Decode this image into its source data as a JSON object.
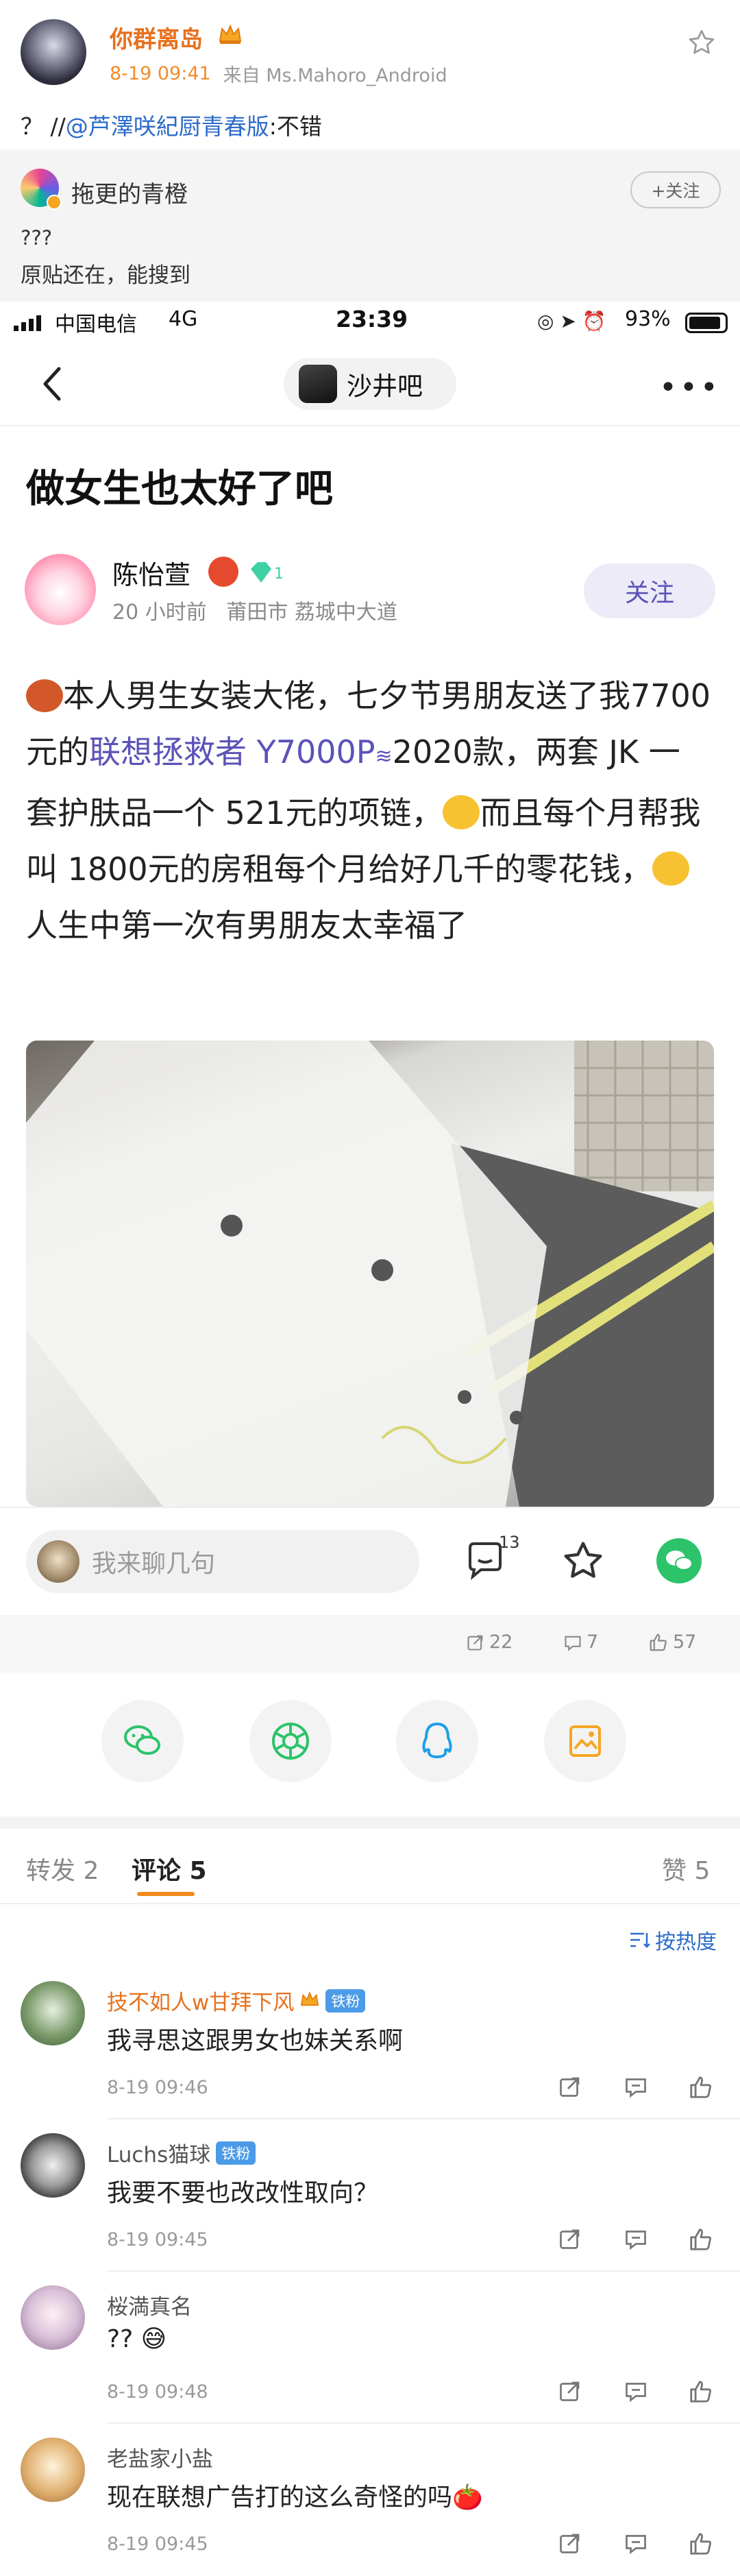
{
  "post": {
    "author": "你群离岛",
    "date": "8-19 09:41",
    "source": "来自 Ms.Mahoro_Android",
    "repost_prefix": "？ //",
    "mention": "@芦澤咲紀厨青春版",
    "repost_suffix": ":不错"
  },
  "quoted": {
    "author": "拖更的青橙",
    "follow_label": "+关注",
    "line1": "???",
    "line2": "原贴还在，能搜到"
  },
  "screenshot": {
    "status": {
      "carrier": "中国电信",
      "network": "4G",
      "time": "23:39",
      "battery": "93%"
    },
    "forum": "沙井吧",
    "title": "做女生也太好了吧",
    "user": {
      "name": "陈怡萱",
      "level": "1",
      "meta": "20 小时前   莆田市 荔城中大道",
      "follow": "关注"
    },
    "body": {
      "p1a": "本人男生女装大佬，七夕节男朋友送了我7700元的",
      "p1link": "联想拯救者 Y7000P",
      "p1b": "2020款，两套 JK 一套护肤品一个 521元的项链，",
      "p1c": "而且每个月帮我叫 1800元的房租每个月给好几千的零花钱，",
      "p1d": "人生中第一次有男朋友太幸福了"
    },
    "chat_placeholder": "我来聊几句",
    "comment_count": "13"
  },
  "stats": {
    "reposts": "22",
    "comments": "7",
    "likes": "57"
  },
  "tabs": {
    "repost": "转发 2",
    "comment": "评论 5",
    "like": "赞 5"
  },
  "sort_label": "按热度",
  "comments": [
    {
      "name": "技不如人w甘拜下风",
      "badge": "铁粉",
      "text": "我寻思这跟男女也妹关系啊",
      "time": "8-19 09:46"
    },
    {
      "name": "Luchs猫球",
      "badge": "铁粉",
      "text": "我要不要也改改性取向？",
      "time": "8-19 09:45"
    },
    {
      "name": "桜満真名",
      "badge": "",
      "text": "?? 😅",
      "time": "8-19 09:48"
    },
    {
      "name": "老盐家小盐",
      "badge": "",
      "text": "现在联想广告打的这么奇怪的吗🍅",
      "time": "8-19 09:45"
    }
  ],
  "colors": {
    "accent_orange": "#e8711d",
    "link_blue": "#2b6bc9",
    "purple": "#5b52b8"
  }
}
